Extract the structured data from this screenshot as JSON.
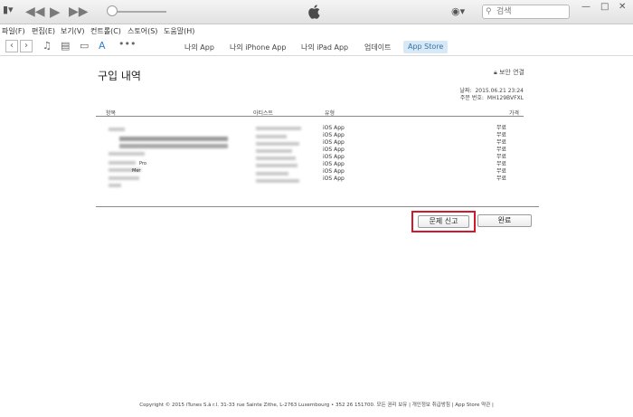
{
  "titlebar": {
    "apple_logo": "apple-logo",
    "search": {
      "placeholder": "검색"
    }
  },
  "menubar": {
    "items": [
      "파일(F)",
      "편집(E)",
      "보기(V)",
      "컨트롤(C)",
      "스토어(S)",
      "도움말(H)"
    ]
  },
  "toolbar": {
    "tabs": [
      "나의 App",
      "나의 iPhone App",
      "나의 iPad App",
      "업데이트",
      "App Store"
    ],
    "active_tab": "App Store",
    "more": "•••"
  },
  "page": {
    "title": "구입 내역",
    "secure_link": "보안 연결",
    "date_label": "날짜:",
    "date_value": "2015.06.21 23:24",
    "order_label": "주문 번호:",
    "order_value": "MH129BVFXL"
  },
  "table": {
    "headers": [
      "항목",
      "아티스트",
      "유형",
      "가격"
    ],
    "rows": [
      {
        "type": "iOS App",
        "price": "무료"
      },
      {
        "type": "iOS App",
        "price": "무료"
      },
      {
        "type": "iOS App",
        "price": "무료"
      },
      {
        "type": "iOS App",
        "price": "무료"
      },
      {
        "type": "iOS App",
        "price": "무료"
      },
      {
        "type": "iOS App",
        "price": "무료"
      },
      {
        "type": "iOS App",
        "price": "무료"
      },
      {
        "type": "iOS App",
        "price": "무료"
      }
    ],
    "partial_item_texts": [
      "Pro",
      "Mer"
    ]
  },
  "buttons": {
    "report": "문제 신고",
    "done": "완료"
  },
  "footer": {
    "text": "Copyright © 2015 iTunes S.à r.l. 31-33 rue Sainte Zithe, L-2763 Luxembourg • 352 26 151700.  모든 권리 보유  |  개인정보 취급방침  |  App Store 약관  |"
  },
  "colors": {
    "highlight": "#d4182b",
    "active_tab_bg": "#d7e9f7"
  }
}
